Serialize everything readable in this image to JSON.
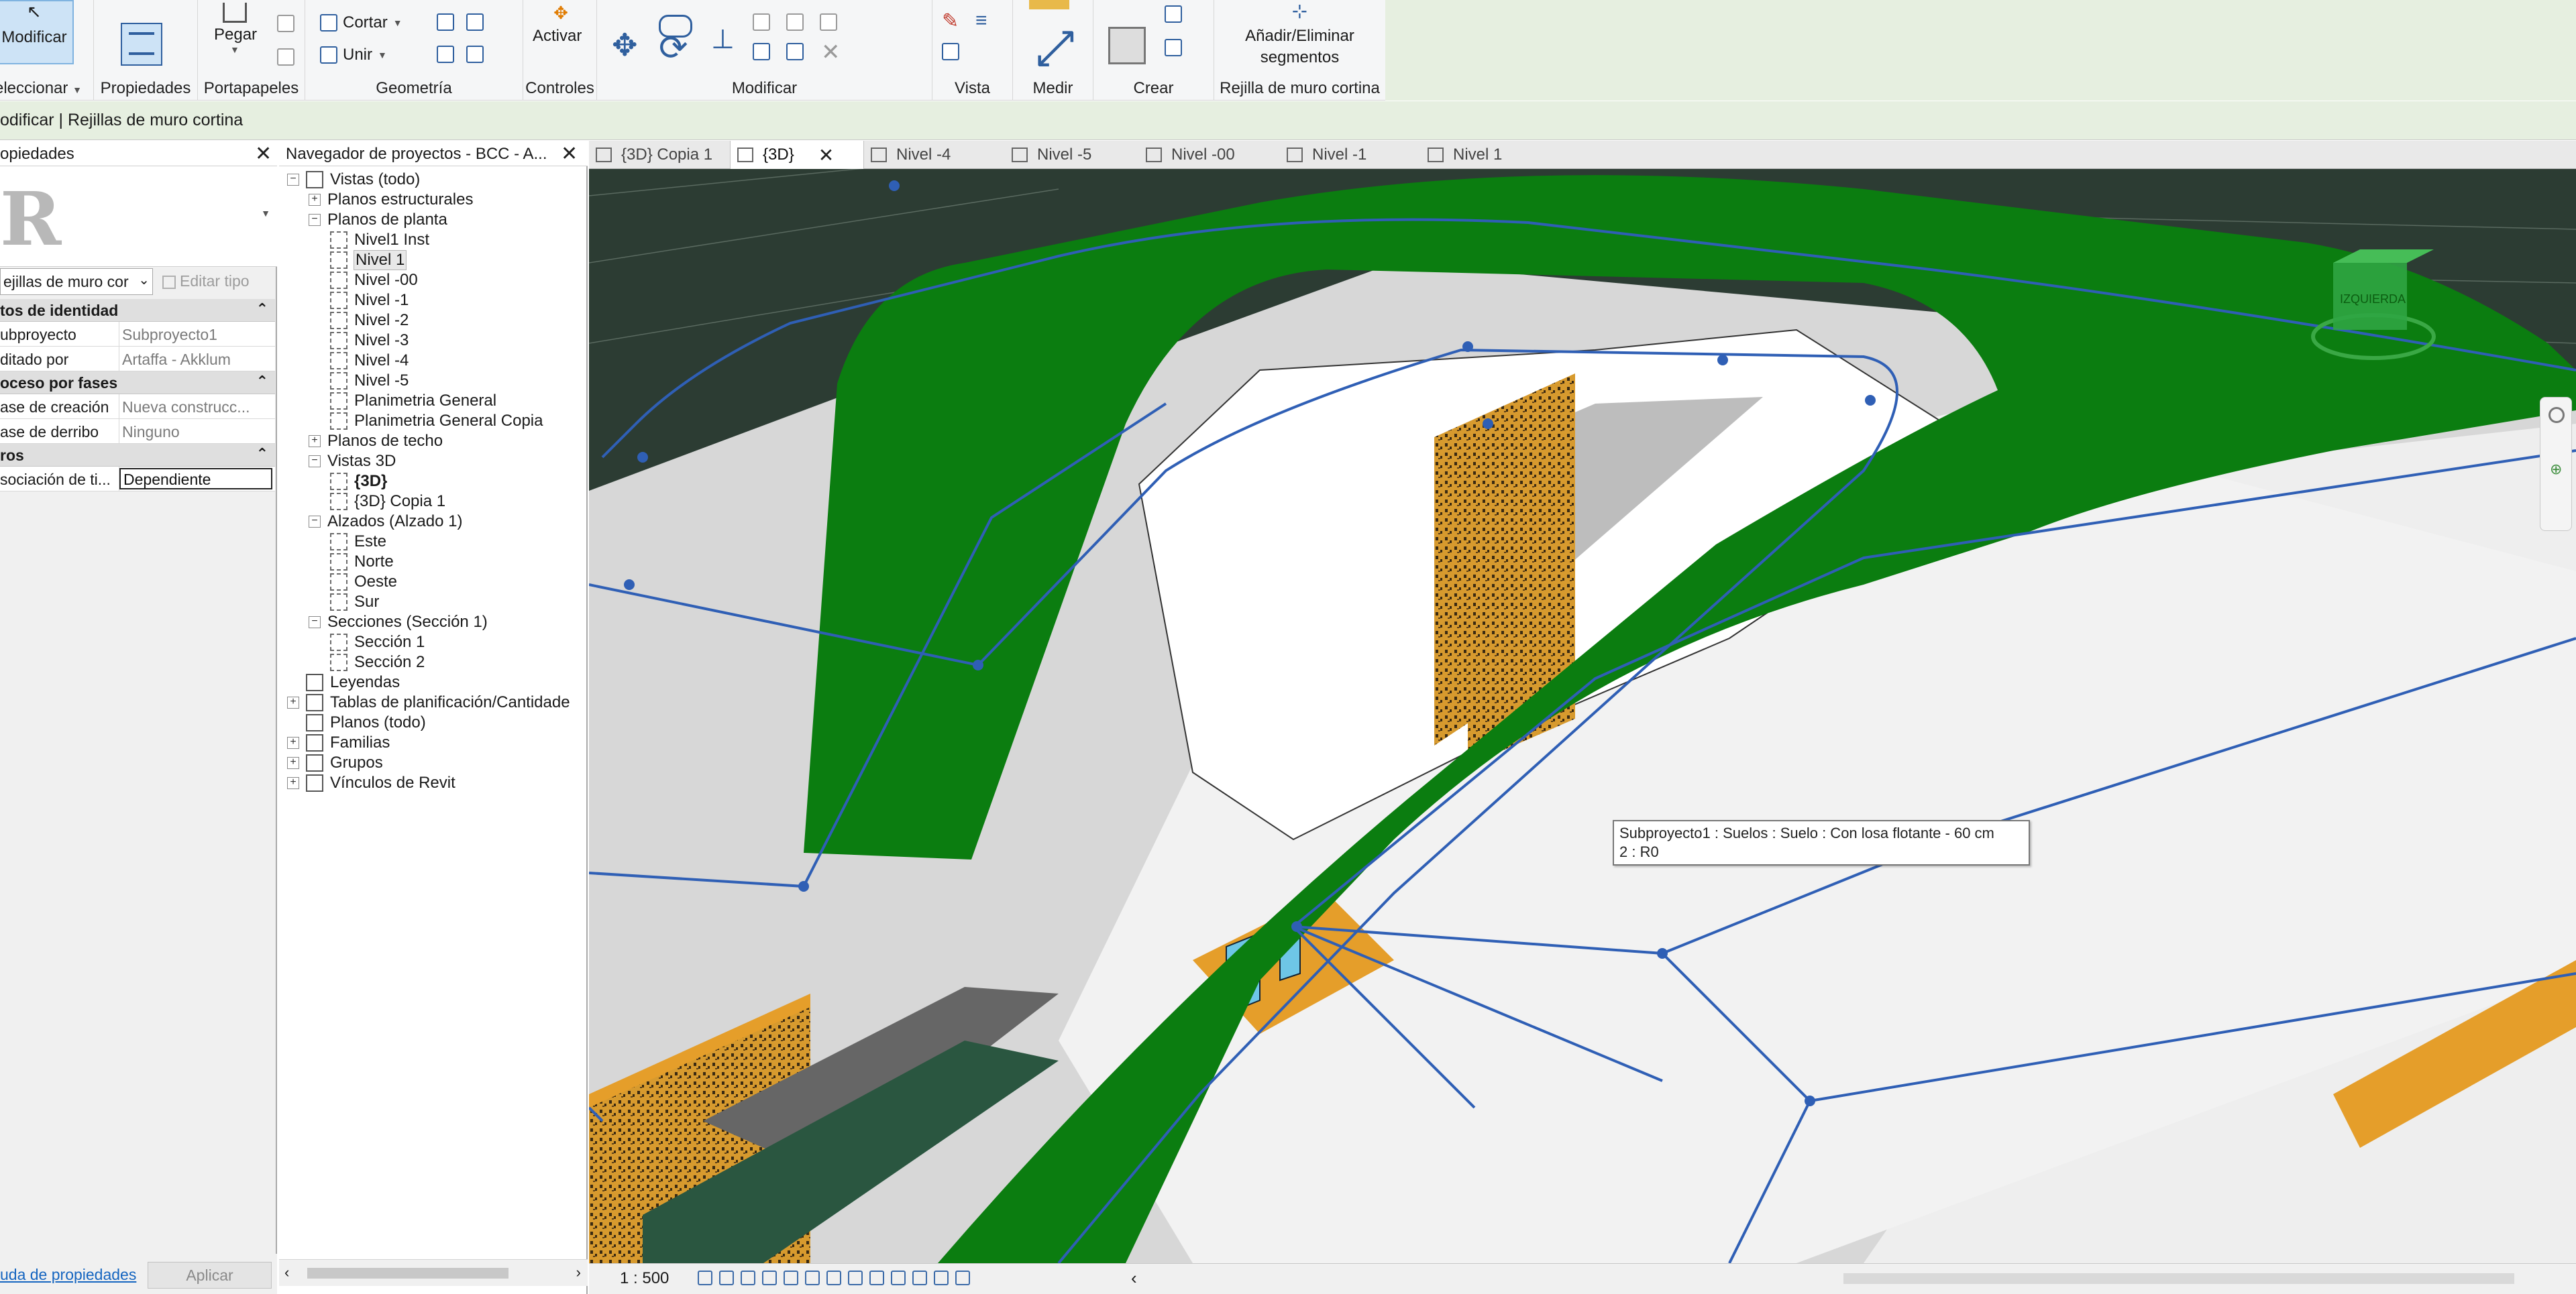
{
  "ribbon": {
    "modify_button": "Modificar",
    "select_label": "eleccionar",
    "groups": {
      "properties": "Propiedades",
      "clipboard": "Portapapeles",
      "geometry": "Geometría",
      "controls": "Controles",
      "modify": "Modificar",
      "view": "Vista",
      "measure": "Medir",
      "create": "Crear",
      "curtain_grid": "Rejilla de muro cortina"
    },
    "paste": "Pegar",
    "cut": "Cortar",
    "join": "Unir",
    "activate": "Activar",
    "add_remove_line1": "Añadir/Eliminar",
    "add_remove_line2": "segmentos"
  },
  "context_bar": "odificar | Rejillas de muro cortina",
  "properties": {
    "title": "opiedades",
    "type_selector": "ejillas de muro cor",
    "edit_type": "Editar tipo",
    "categories": [
      {
        "label": "tos de identidad",
        "rows": [
          {
            "key": "ubproyecto",
            "value": "Subproyecto1"
          },
          {
            "key": "ditado por",
            "value": "Artaffa - Akklum"
          }
        ]
      },
      {
        "label": "oceso por fases",
        "rows": [
          {
            "key": "ase de creación",
            "value": "Nueva construcc..."
          },
          {
            "key": "ase de derribo",
            "value": "Ninguno"
          }
        ]
      },
      {
        "label": "ros",
        "rows": [
          {
            "key": "sociación de ti...",
            "value": "Dependiente"
          }
        ]
      }
    ],
    "help_link": "uda de propiedades",
    "apply": "Aplicar"
  },
  "browser": {
    "title": "Navegador de proyectos - BCC - A...",
    "items": [
      {
        "label": "Vistas (todo)",
        "level": 0,
        "toggle": "−",
        "icon": "views-icon"
      },
      {
        "label": "Planos estructurales",
        "level": 1,
        "toggle": "+"
      },
      {
        "label": "Planos de planta",
        "level": 1,
        "toggle": "−"
      },
      {
        "label": "Nivel1 Inst",
        "level": 2
      },
      {
        "label": "Nivel 1",
        "level": 2,
        "selected": true
      },
      {
        "label": "Nivel -00",
        "level": 2
      },
      {
        "label": "Nivel -1",
        "level": 2
      },
      {
        "label": "Nivel -2",
        "level": 2
      },
      {
        "label": "Nivel -3",
        "level": 2
      },
      {
        "label": "Nivel -4",
        "level": 2
      },
      {
        "label": "Nivel -5",
        "level": 2
      },
      {
        "label": "Planimetria General",
        "level": 2
      },
      {
        "label": "Planimetria General Copia",
        "level": 2
      },
      {
        "label": "Planos de techo",
        "level": 1,
        "toggle": "+"
      },
      {
        "label": "Vistas 3D",
        "level": 1,
        "toggle": "−"
      },
      {
        "label": "{3D}",
        "level": 2,
        "bold": true
      },
      {
        "label": "{3D} Copia 1",
        "level": 2
      },
      {
        "label": "Alzados (Alzado 1)",
        "level": 1,
        "toggle": "−"
      },
      {
        "label": "Este",
        "level": 2
      },
      {
        "label": "Norte",
        "level": 2
      },
      {
        "label": "Oeste",
        "level": 2
      },
      {
        "label": "Sur",
        "level": 2
      },
      {
        "label": "Secciones (Sección 1)",
        "level": 1,
        "toggle": "−"
      },
      {
        "label": "Sección 1",
        "level": 2
      },
      {
        "label": "Sección 2",
        "level": 2
      },
      {
        "label": "Leyendas",
        "level": 0,
        "icon": "legend-icon"
      },
      {
        "label": "Tablas de planificación/Cantidade",
        "level": 0,
        "toggle": "+",
        "icon": "schedule-icon"
      },
      {
        "label": "Planos (todo)",
        "level": 0,
        "icon": "sheet-icon"
      },
      {
        "label": "Familias",
        "level": 0,
        "toggle": "+",
        "icon": "family-icon"
      },
      {
        "label": "Grupos",
        "level": 0,
        "toggle": "+",
        "icon": "group-icon"
      },
      {
        "label": "Vínculos de Revit",
        "level": 0,
        "toggle": "+",
        "icon": "link-icon"
      }
    ]
  },
  "tabs": [
    {
      "label": "{3D} Copia 1",
      "active": false
    },
    {
      "label": "{3D}",
      "active": true
    },
    {
      "label": "Nivel -4",
      "active": false
    },
    {
      "label": "Nivel -5",
      "active": false
    },
    {
      "label": "Nivel -00",
      "active": false
    },
    {
      "label": "Nivel -1",
      "active": false
    },
    {
      "label": "Nivel 1",
      "active": false
    }
  ],
  "viewport": {
    "tooltip_line1": "Subproyecto1 : Suelos : Suelo : Con losa flotante - 60 cm",
    "tooltip_line2": "2 : R0",
    "viewcube_label": "IZQUIERDA"
  },
  "status": {
    "scale": "1 : 500"
  },
  "colors": {
    "roof_green": "#0b7d10",
    "grid_blue": "#2f5fb5",
    "panel_orange": "#e59e2a",
    "ribbon_bg": "#f5f6f7",
    "context_bg": "#e6efe0"
  }
}
